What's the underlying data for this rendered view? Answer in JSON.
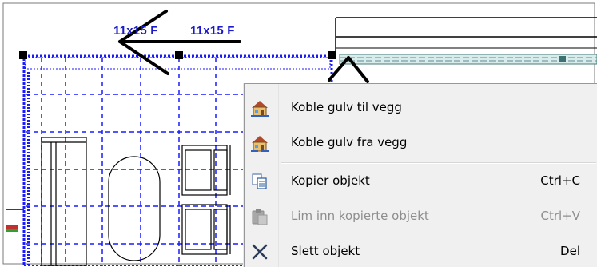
{
  "drawing": {
    "dimension_labels": [
      "11x15 F",
      "11x15 F"
    ],
    "colors": {
      "dimension_text": "#1a1acc",
      "grid_lines": "#1a1aff",
      "wall_fill": "#d9ecec",
      "menu_bg": "#f0f0f0"
    }
  },
  "context_menu": {
    "items": [
      {
        "label": "Koble gulv til vegg",
        "shortcut": "",
        "icon": "house-connect-icon",
        "enabled": true
      },
      {
        "label": "Koble gulv fra vegg",
        "shortcut": "",
        "icon": "house-disconnect-icon",
        "enabled": true
      },
      {
        "label": "Kopier objekt",
        "shortcut": "Ctrl+C",
        "icon": "copy-icon",
        "enabled": true
      },
      {
        "label": "Lim inn kopierte objekt",
        "shortcut": "Ctrl+V",
        "icon": "paste-icon",
        "enabled": false
      },
      {
        "label": "Slett objekt",
        "shortcut": "Del",
        "icon": "delete-icon",
        "enabled": true
      }
    ]
  }
}
